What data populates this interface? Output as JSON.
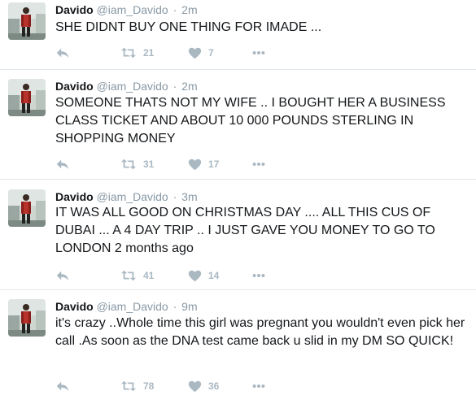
{
  "tweets": [
    {
      "name": "Davido",
      "handle": "@iam_Davido",
      "separator": "·",
      "time": "2m",
      "text": "SHE DIDNT BUY ONE THING FOR IMADE ...",
      "retweets": "21",
      "likes": "7"
    },
    {
      "name": "Davido",
      "handle": "@iam_Davido",
      "separator": "·",
      "time": "2m",
      "text": "SOMEONE THATS NOT MY WIFE .. I BOUGHT HER A BUSINESS CLASS TICKET AND ABOUT 10 000 POUNDS STERLING IN SHOPPING MONEY",
      "retweets": "31",
      "likes": "17"
    },
    {
      "name": "Davido",
      "handle": "@iam_Davido",
      "separator": "·",
      "time": "3m",
      "text": "IT WAS ALL GOOD ON CHRISTMAS DAY .... ALL THIS CUS OF DUBAI ... A 4 DAY TRIP .. I JUST GAVE YOU MONEY TO GO TO LONDON 2 months ago",
      "retweets": "41",
      "likes": "14"
    },
    {
      "name": "Davido",
      "handle": "@iam_Davido",
      "separator": "·",
      "time": "9m",
      "text": "it's crazy ..Whole time this girl was pregnant you wouldn't even pick her call .As soon as the DNA test came back u slid in my DM SO QUICK!",
      "retweets": "78",
      "likes": "36"
    }
  ],
  "icons": {
    "reply": "reply-icon",
    "retweet": "retweet-icon",
    "like": "heart-icon",
    "more": "more-icon"
  },
  "colors": {
    "text": "#14171a",
    "meta": "#8899a6",
    "action": "#aab8c2",
    "divider": "#e1e8ed"
  }
}
